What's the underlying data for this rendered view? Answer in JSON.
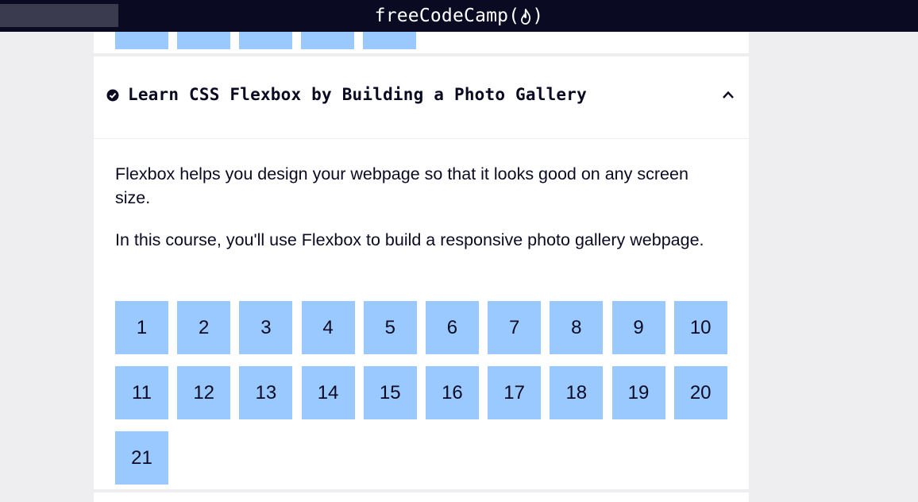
{
  "brand": {
    "name": "freeCodeCamp"
  },
  "course": {
    "title": "Learn CSS Flexbox by Building a Photo Gallery",
    "description": [
      "Flexbox helps you design your webpage so that it looks good on any screen size.",
      "In this course, you'll use Flexbox to build a responsive photo gallery webpage."
    ],
    "steps": [
      "1",
      "2",
      "3",
      "4",
      "5",
      "6",
      "7",
      "8",
      "9",
      "10",
      "11",
      "12",
      "13",
      "14",
      "15",
      "16",
      "17",
      "18",
      "19",
      "20",
      "21"
    ]
  },
  "colors": {
    "nav_bg": "#0a0a23",
    "step_bg": "#99c9ff",
    "page_bg": "#eeeef0",
    "text": "#0a0a23"
  },
  "icons": {
    "completed": "check-circle-icon",
    "collapse": "chevron-up-icon",
    "brand_flame": "flame-icon"
  }
}
